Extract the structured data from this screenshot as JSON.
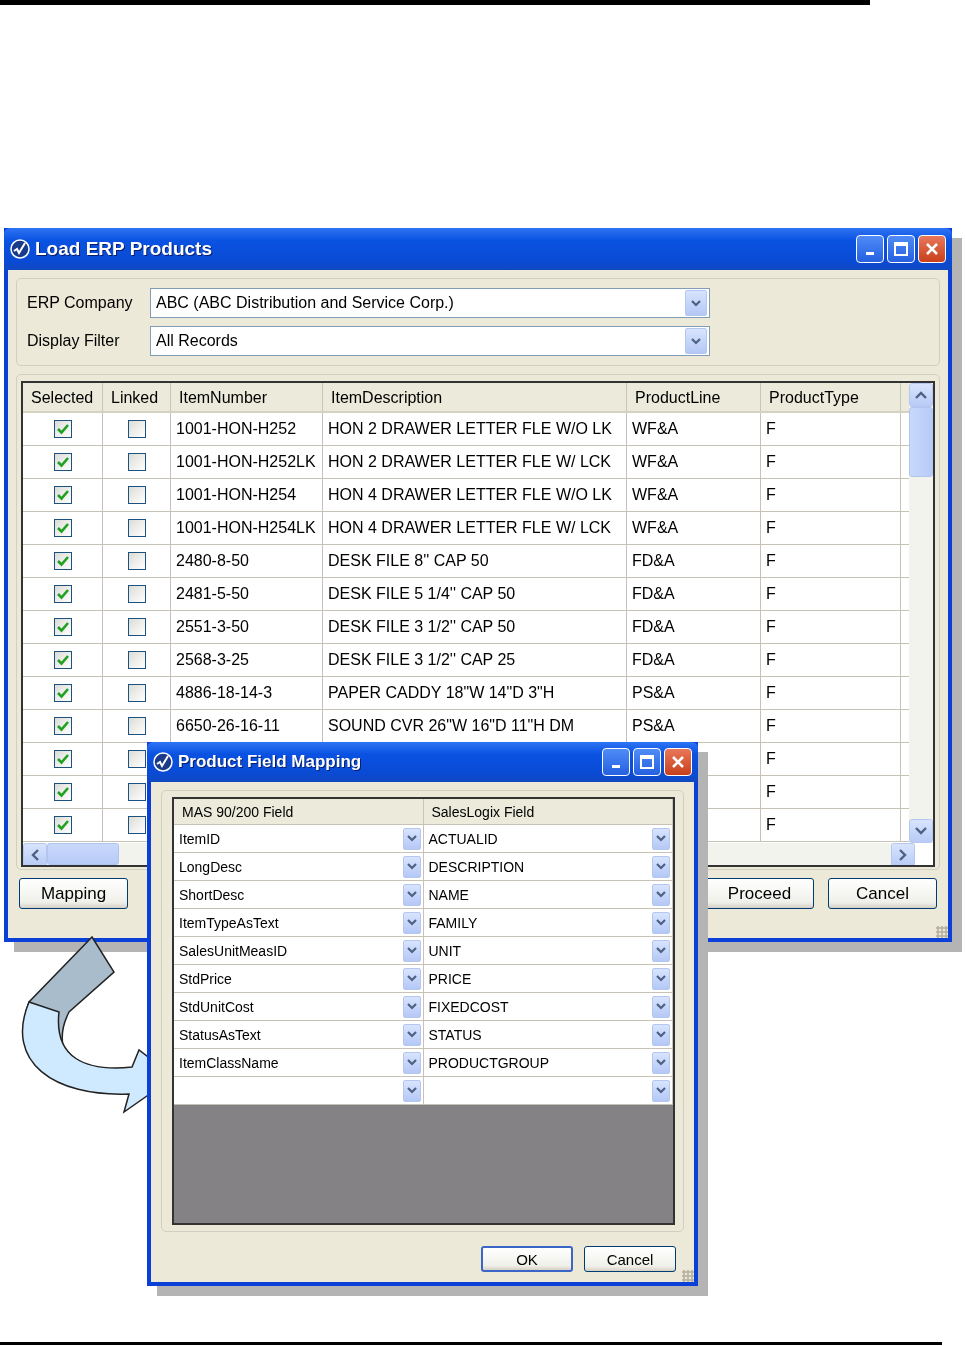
{
  "main_window": {
    "title": "Load ERP Products",
    "filters": [
      {
        "label": "ERP Company",
        "value": "ABC  (ABC Distribution and Service Corp.)"
      },
      {
        "label": "Display Filter",
        "value": "All Records"
      }
    ],
    "table": {
      "columns": [
        "Selected",
        "Linked",
        "ItemNumber",
        "ItemDescription",
        "ProductLine",
        "ProductType"
      ],
      "rows": [
        {
          "selected": true,
          "linked": false,
          "item_number": "1001-HON-H252",
          "item_description": "HON 2 DRAWER LETTER FLE W/O LK",
          "product_line": "WF&A",
          "product_type": "F"
        },
        {
          "selected": true,
          "linked": false,
          "item_number": "1001-HON-H252LK",
          "item_description": "HON 2 DRAWER LETTER FLE W/ LCK",
          "product_line": "WF&A",
          "product_type": "F"
        },
        {
          "selected": true,
          "linked": false,
          "item_number": "1001-HON-H254",
          "item_description": "HON 4 DRAWER LETTER FLE W/O LK",
          "product_line": "WF&A",
          "product_type": "F"
        },
        {
          "selected": true,
          "linked": false,
          "item_number": "1001-HON-H254LK",
          "item_description": "HON 4 DRAWER LETTER FLE W/ LCK",
          "product_line": "WF&A",
          "product_type": "F"
        },
        {
          "selected": true,
          "linked": false,
          "item_number": "2480-8-50",
          "item_description": "DESK FILE 8'' CAP 50",
          "product_line": "FD&A",
          "product_type": "F"
        },
        {
          "selected": true,
          "linked": false,
          "item_number": "2481-5-50",
          "item_description": "DESK FILE 5 1/4'' CAP 50",
          "product_line": "FD&A",
          "product_type": "F"
        },
        {
          "selected": true,
          "linked": false,
          "item_number": "2551-3-50",
          "item_description": "DESK FILE 3 1/2'' CAP 50",
          "product_line": "FD&A",
          "product_type": "F"
        },
        {
          "selected": true,
          "linked": false,
          "item_number": "2568-3-25",
          "item_description": "DESK FILE 3 1/2'' CAP 25",
          "product_line": "FD&A",
          "product_type": "F"
        },
        {
          "selected": true,
          "linked": false,
          "item_number": "4886-18-14-3",
          "item_description": "PAPER CADDY 18\"W 14\"D 3\"H",
          "product_line": "PS&A",
          "product_type": "F"
        },
        {
          "selected": true,
          "linked": false,
          "item_number": "6650-26-16-11",
          "item_description": "SOUND CVR 26\"W 16\"D 11\"H DM",
          "product_line": "PS&A",
          "product_type": "F"
        },
        {
          "selected": true,
          "linked": false,
          "product_type": "F"
        },
        {
          "selected": true,
          "linked": false,
          "product_type": "F"
        },
        {
          "selected": true,
          "linked": false,
          "product_type": "F"
        }
      ]
    },
    "left_buttons": [
      {
        "label": "Mapping"
      }
    ],
    "right_buttons": [
      {
        "label": "Proceed"
      },
      {
        "label": "Cancel"
      }
    ]
  },
  "mapping_dialog": {
    "title": "Product Field Mapping",
    "columns": [
      "MAS 90/200  Field",
      "SalesLogix Field"
    ],
    "rows": [
      {
        "source": "ItemID",
        "target": "ACTUALID"
      },
      {
        "source": "LongDesc",
        "target": "DESCRIPTION"
      },
      {
        "source": "ShortDesc",
        "target": "NAME"
      },
      {
        "source": "ItemTypeAsText",
        "target": "FAMILY"
      },
      {
        "source": "SalesUnitMeasID",
        "target": "UNIT"
      },
      {
        "source": "StdPrice",
        "target": "PRICE"
      },
      {
        "source": "StdUnitCost",
        "target": "FIXEDCOST"
      },
      {
        "source": "StatusAsText",
        "target": "STATUS"
      },
      {
        "source": "ItemClassName",
        "target": "PRODUCTGROUP"
      }
    ],
    "buttons": [
      {
        "label": "OK",
        "default": true
      },
      {
        "label": "Cancel",
        "default": false
      }
    ]
  }
}
